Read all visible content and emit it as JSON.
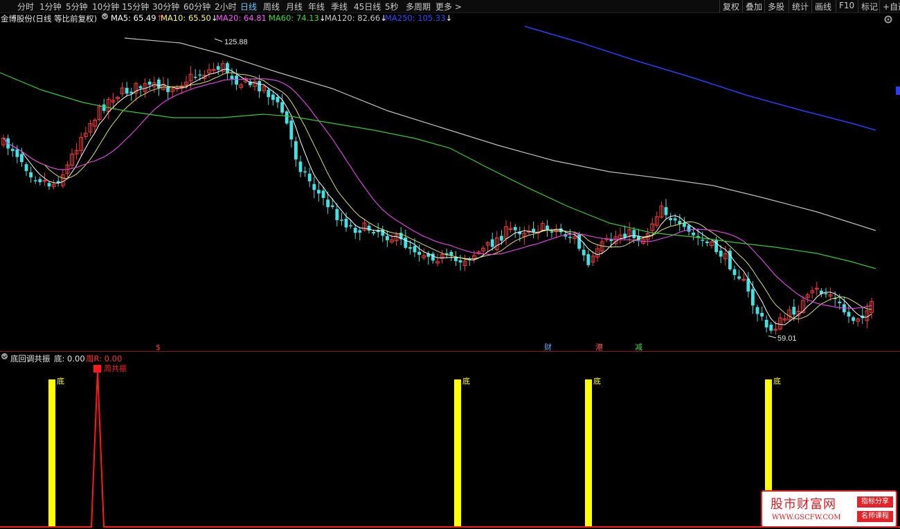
{
  "toolbar": {
    "timeframes": [
      "分时",
      "1分钟",
      "5分钟",
      "10分钟",
      "15分钟",
      "30分钟",
      "60分钟",
      "2小时",
      "日线",
      "周线",
      "月线",
      "年线",
      "季线",
      "45日线",
      "5秒",
      "多周期",
      "更多 >"
    ],
    "active": "日线",
    "right_buttons": [
      "复权",
      "叠加",
      "多股",
      "统计",
      "画线",
      "F10",
      "标记",
      "+自选"
    ]
  },
  "main_panel": {
    "title": "金博股份(日线 等比前复权)",
    "ma": [
      {
        "label": "MA5: 65.49",
        "arrow": "↑",
        "color": "#ffffff",
        "arrow_color": "#ff3030"
      },
      {
        "label": "MA10: 65.50",
        "arrow": "↓",
        "color": "#ffff66",
        "arrow_color": "#ffffff"
      },
      {
        "label": "MA20: 64.81",
        "arrow": "↑",
        "color": "#ff55ff",
        "arrow_color": "#ff3030"
      },
      {
        "label": "MA60: 74.13",
        "arrow": "↓",
        "color": "#33dd33",
        "arrow_color": "#ffffff"
      },
      {
        "label": "MA120: 82.66",
        "arrow": "↓",
        "color": "#c8c8c8",
        "arrow_color": "#ffffff"
      },
      {
        "label": "MA250: 105.33",
        "arrow": "↓",
        "color": "#3344ff",
        "arrow_color": "#ffffff"
      }
    ],
    "high_label": "125.88",
    "low_label": "59.01",
    "event_markers": [
      {
        "text": "$",
        "color": "#ff3333"
      },
      {
        "text": "财",
        "color": "#6aa8ff"
      },
      {
        "text": "港",
        "color": "#ff5555"
      },
      {
        "text": "减",
        "color": "#44dd44"
      }
    ]
  },
  "indicator_panel": {
    "name": "底回调共振",
    "values": [
      {
        "label": "底: 0.00",
        "color": "#e8e8e8"
      },
      {
        "label": "周R: 0.00",
        "color": "#ff3030"
      }
    ],
    "bar_label": "底",
    "bar_signal_count": 4,
    "pulse_label": "周共振"
  },
  "colors": {
    "up": "#ff3a3a",
    "down": "#3fe3e3",
    "ma5": "#ffffff",
    "ma10": "#e0e060",
    "ma20": "#e040e0",
    "ma60": "#33cc33",
    "ma120": "#bdbdbd",
    "ma250": "#2a3dff",
    "signal_bar": "#ffff00",
    "pulse": "#ff1a1a"
  },
  "watermark": {
    "title": "股市财富网",
    "url": "WWW.GSCFW.COM",
    "badge1": "指标分享",
    "badge2": "名师课程"
  }
}
